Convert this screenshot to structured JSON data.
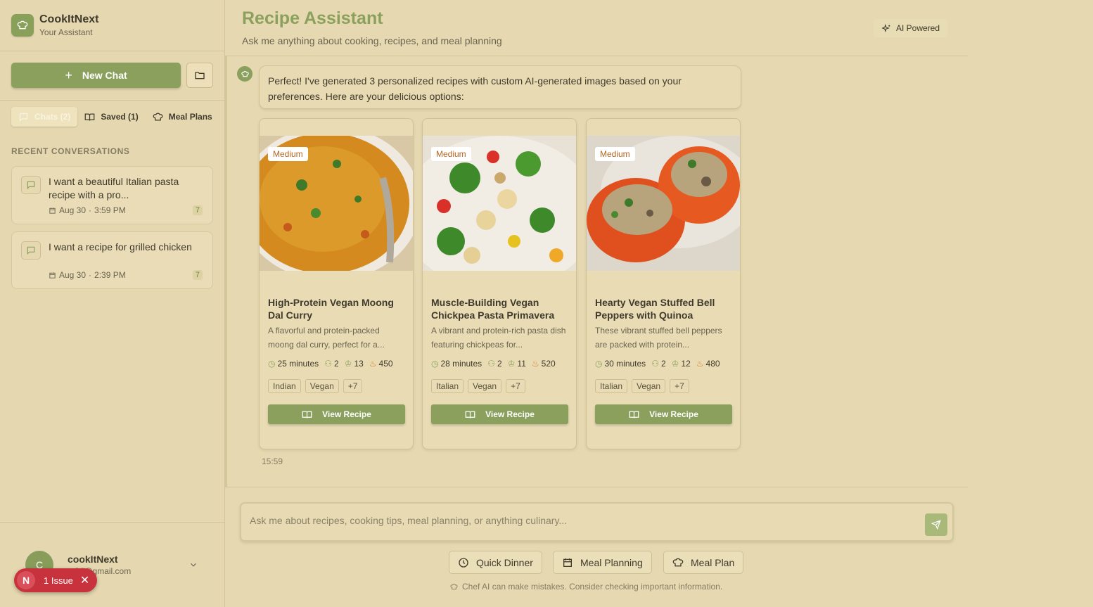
{
  "brand": {
    "title": "CookItNext",
    "subtitle": "Your Assistant"
  },
  "sidebar": {
    "new_chat_label": "New Chat",
    "tabs": [
      {
        "label": "Chats (2)"
      },
      {
        "label": "Saved (1)"
      },
      {
        "label": "Meal Plans"
      }
    ],
    "section_label": "RECENT CONVERSATIONS",
    "conversations": [
      {
        "title": "I want a beautiful Italian pasta recipe with a pro...",
        "date": "Aug 30",
        "time": "3:59 PM",
        "count": "7"
      },
      {
        "title": "I want a recipe for grilled chicken",
        "date": "Aug 30",
        "time": "2:39 PM",
        "count": "7"
      }
    ],
    "user": {
      "initial": "C",
      "name": "cookItNext",
      "email": "...84@gmail.com"
    }
  },
  "issue": {
    "initial": "N",
    "label": "1 Issue"
  },
  "header": {
    "title": "Recipe Assistant",
    "subtitle": "Ask me anything about cooking, recipes, and meal planning",
    "badge": "AI Powered"
  },
  "message": {
    "text": "Perfect! I've generated 3 personalized recipes with custom AI-generated images based on your preferences. Here are your delicious options:",
    "time": "15:59"
  },
  "recipes": [
    {
      "difficulty": "Medium",
      "title": "High-Protein Vegan Moong Dal Curry",
      "description": "A flavorful and protein-packed moong dal curry, perfect for a...",
      "time": "25 minutes",
      "servings": "2",
      "ingredients": "13",
      "calories": "450",
      "tags": [
        "Indian",
        "Vegan",
        "+7"
      ],
      "button": "View Recipe"
    },
    {
      "difficulty": "Medium",
      "title": "Muscle-Building Vegan Chickpea Pasta Primavera",
      "description": "A vibrant and protein-rich pasta dish featuring chickpeas for...",
      "time": "28 minutes",
      "servings": "2",
      "ingredients": "11",
      "calories": "520",
      "tags": [
        "Italian",
        "Vegan",
        "+7"
      ],
      "button": "View Recipe"
    },
    {
      "difficulty": "Medium",
      "title": "Hearty Vegan Stuffed Bell Peppers with Quinoa",
      "description": "These vibrant stuffed bell peppers are packed with protein...",
      "time": "30 minutes",
      "servings": "2",
      "ingredients": "12",
      "calories": "480",
      "tags": [
        "Italian",
        "Vegan",
        "+7"
      ],
      "button": "View Recipe"
    }
  ],
  "input": {
    "placeholder": "Ask me about recipes, cooking tips, meal planning, or anything culinary..."
  },
  "quick_actions": [
    {
      "label": "Quick Dinner",
      "icon": "clock-icon"
    },
    {
      "label": "Meal Planning",
      "icon": "calendar-icon"
    },
    {
      "label": "Meal Plan",
      "icon": "chef-hat-icon"
    }
  ],
  "disclaimer": "Chef AI can make mistakes. Consider checking important information.",
  "colors": {
    "accent": "#8aa05c",
    "background": "#e6d9b1",
    "issue": "#c8323c"
  }
}
